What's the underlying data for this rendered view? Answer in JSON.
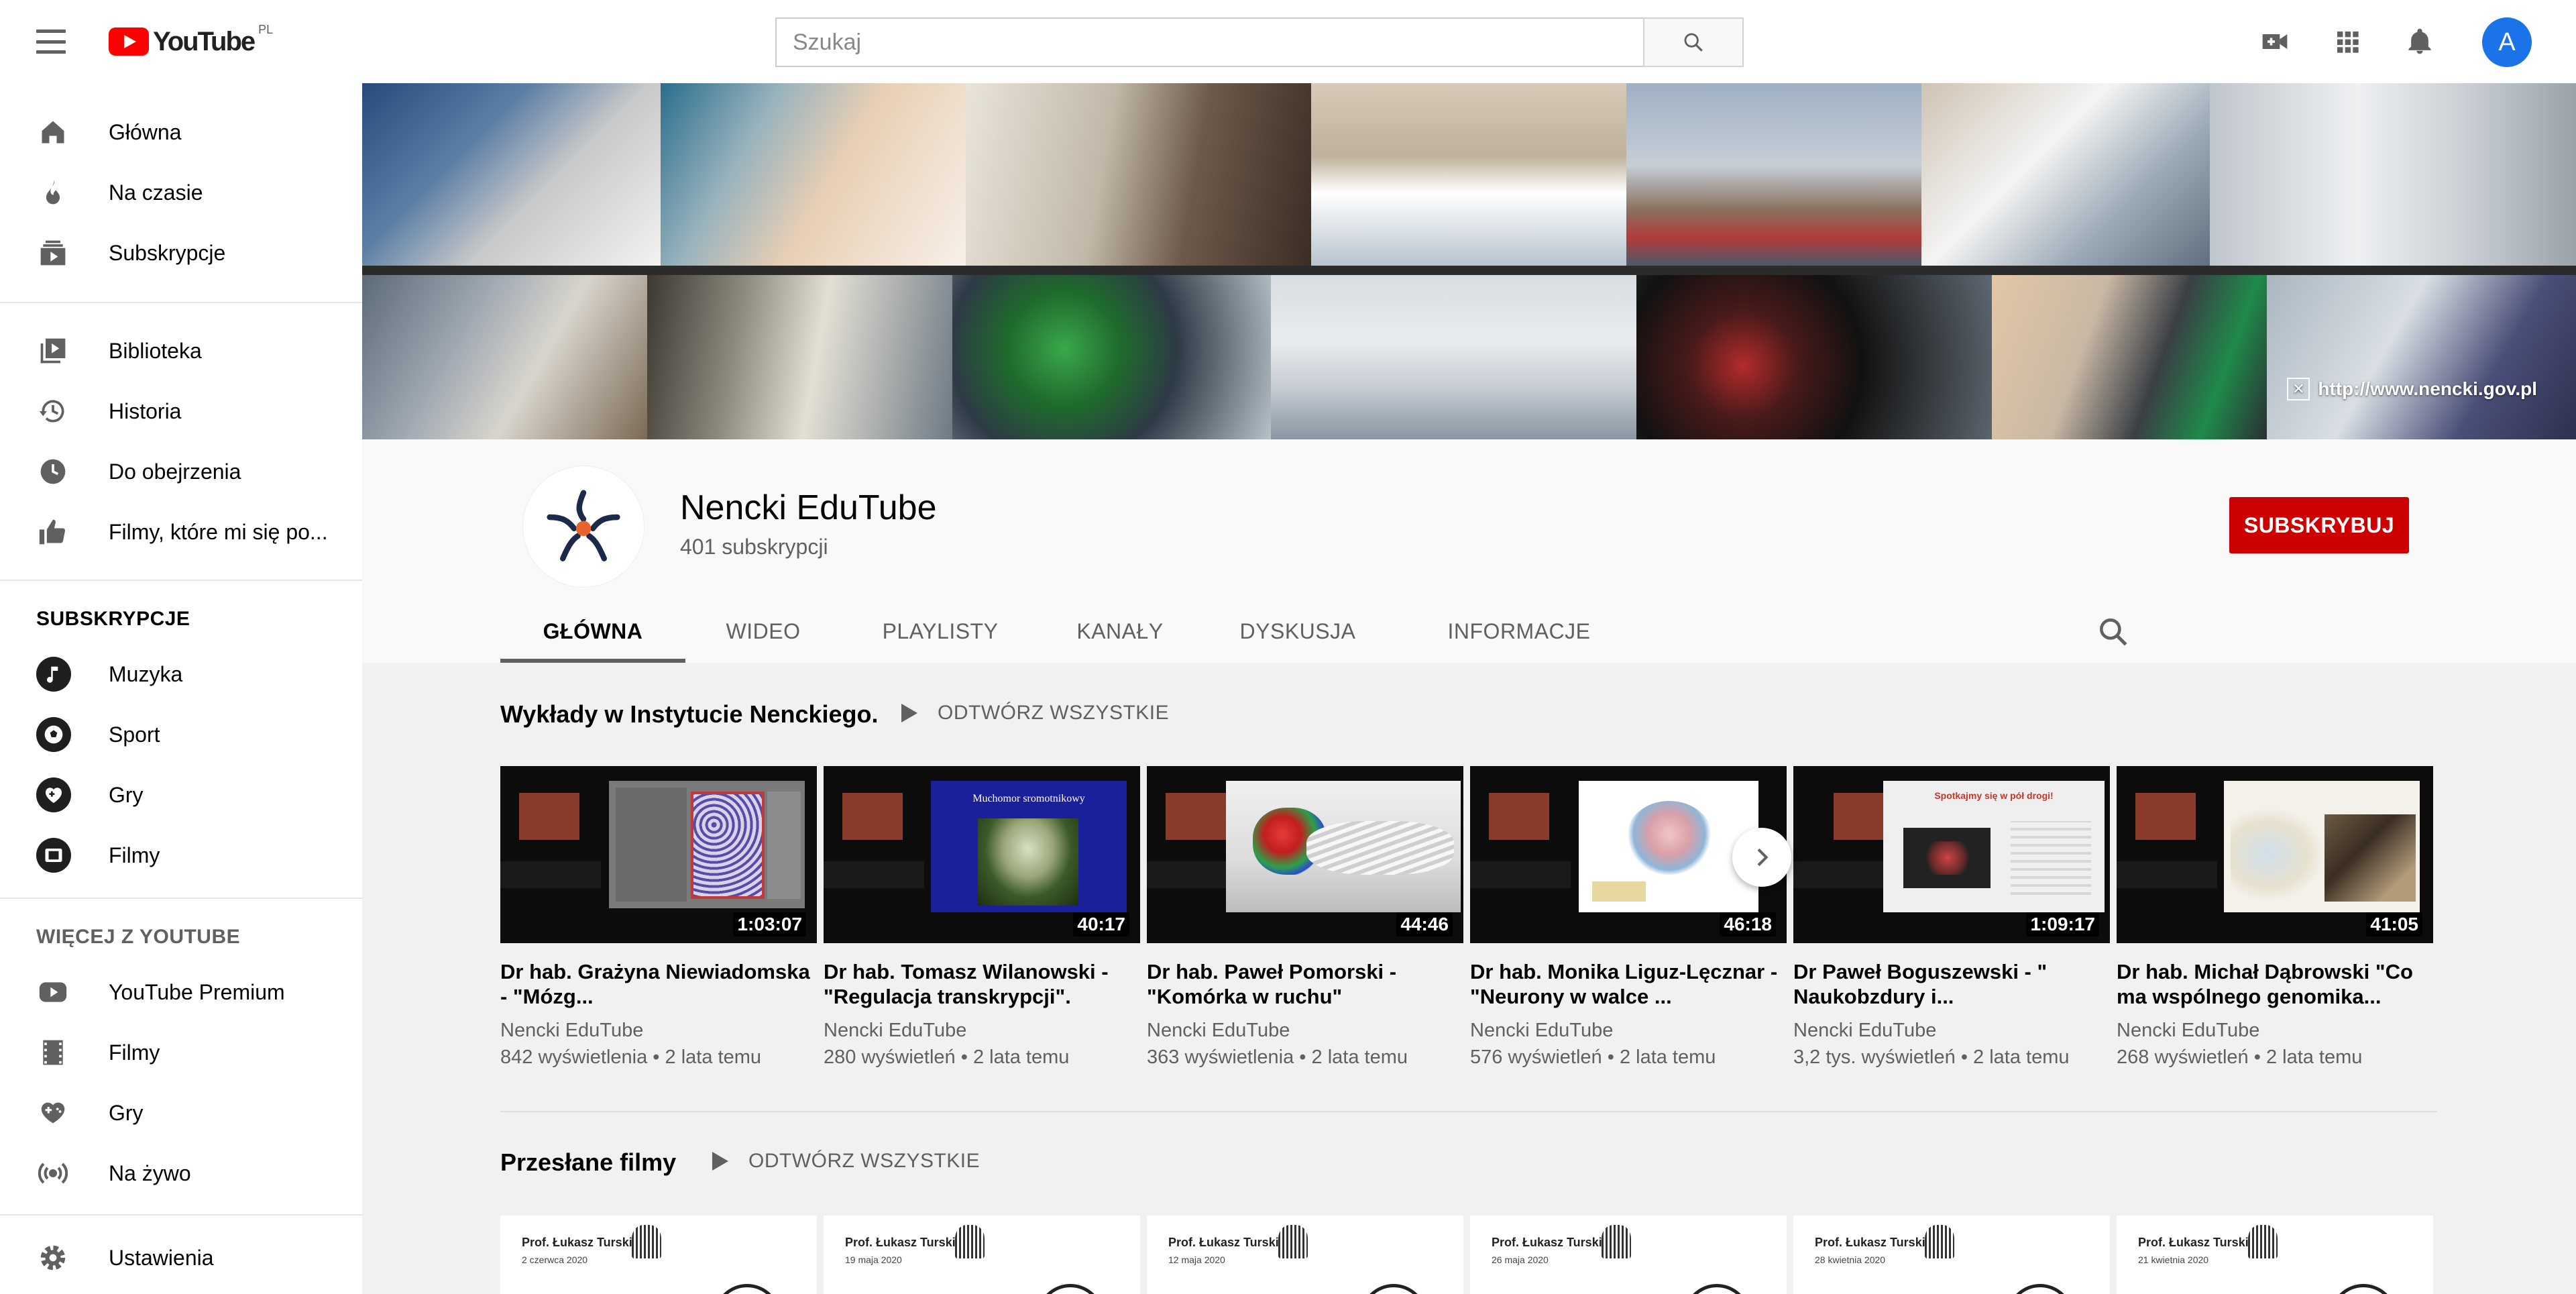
{
  "header": {
    "logo_text": "YouTube",
    "region": "PL",
    "search_placeholder": "Szukaj",
    "avatar_letter": "A",
    "icons": [
      "menu-icon",
      "search-icon",
      "create-video-icon",
      "apps-icon",
      "notifications-icon"
    ]
  },
  "sidebar": {
    "main": [
      {
        "label": "Główna",
        "icon": "home-icon"
      },
      {
        "label": "Na czasie",
        "icon": "fire-icon"
      },
      {
        "label": "Subskrypcje",
        "icon": "subscriptions-icon"
      }
    ],
    "library": [
      {
        "label": "Biblioteka",
        "icon": "library-icon"
      },
      {
        "label": "Historia",
        "icon": "history-icon"
      },
      {
        "label": "Do obejrzenia",
        "icon": "clock-icon"
      },
      {
        "label": "Filmy, które mi się po...",
        "icon": "thumbs-up-icon"
      }
    ],
    "subscriptions_heading": "SUBSKRYPCJE",
    "subscriptions": [
      {
        "label": "Muzyka",
        "icon": "music-icon"
      },
      {
        "label": "Sport",
        "icon": "sport-icon"
      },
      {
        "label": "Gry",
        "icon": "gaming-icon"
      },
      {
        "label": "Filmy",
        "icon": "film-icon"
      }
    ],
    "more_heading": "WIĘCEJ Z YOUTUBE",
    "more": [
      {
        "label": "YouTube Premium",
        "icon": "youtube-premium-icon"
      },
      {
        "label": "Filmy",
        "icon": "film-strip-icon"
      },
      {
        "label": "Gry",
        "icon": "gamepad-icon"
      },
      {
        "label": "Na żywo",
        "icon": "live-icon"
      }
    ],
    "settings": {
      "label": "Ustawienia",
      "icon": "settings-icon"
    }
  },
  "banner": {
    "url_text": "http://www.nencki.gov.pl"
  },
  "channel": {
    "name": "Nencki EduTube",
    "subscribers": "401 subskrypcji",
    "subscribe_label": "SUBSKRYBUJ",
    "tabs": [
      "GŁÓWNA",
      "WIDEO",
      "PLAYLISTY",
      "KANAŁY",
      "DYSKUSJA",
      "INFORMACJE"
    ],
    "active_tab": 0,
    "colors": {
      "subscribe": "#cc0000",
      "logo_orange": "#e8622a",
      "logo_navy": "#1b2a4a"
    }
  },
  "shelves": [
    {
      "title": "Wykłady w Instytucie Nenckiego.",
      "play_all": "ODTWÓRZ WSZYSTKIE",
      "videos": [
        {
          "title": "Dr hab. Grażyna Niewiadomska - \"Mózg...",
          "channel": "Nencki EduTube",
          "views": "842 wyświetlenia",
          "age": "2 lata temu",
          "duration": "1:03:07"
        },
        {
          "title": "Dr hab. Tomasz Wilanowski - \"Regulacja transkrypcji\".",
          "channel": "Nencki EduTube",
          "views": "280 wyświetleń",
          "age": "2 lata temu",
          "duration": "40:17",
          "slide_title": "Muchomor sromotnikowy"
        },
        {
          "title": "Dr hab. Paweł Pomorski - \"Komórka w ruchu\"",
          "channel": "Nencki EduTube",
          "views": "363 wyświetlenia",
          "age": "2 lata temu",
          "duration": "44:46"
        },
        {
          "title": "Dr hab. Monika Liguz-Lęcznar - \"Neurony w walce ...",
          "channel": "Nencki EduTube",
          "views": "576 wyświetleń",
          "age": "2 lata temu",
          "duration": "46:18"
        },
        {
          "title": "Dr Paweł Boguszewski - \" Naukobzdury i...",
          "channel": "Nencki EduTube",
          "views": "3,2 tys. wyświetleń",
          "age": "2 lata temu",
          "duration": "1:09:17",
          "slide_title": "Spotkajmy się w pół drogi!"
        },
        {
          "title": "Dr hab. Michał Dąbrowski \"Co ma wspólnego genomika...",
          "channel": "Nencki EduTube",
          "views": "268 wyświetleń",
          "age": "2 lata temu",
          "duration": "41:05"
        }
      ]
    },
    {
      "title": "Przesłane filmy",
      "play_all": "ODTWÓRZ WSZYSTKIE",
      "uploads": [
        {
          "speaker": "Prof. Łukasz Turski",
          "date": "2 czerwca 2020"
        },
        {
          "speaker": "Prof. Łukasz Turski",
          "date": "19 maja 2020"
        },
        {
          "speaker": "Prof. Łukasz Turski",
          "date": "12 maja 2020"
        },
        {
          "speaker": "Prof. Łukasz Turski",
          "date": "26 maja 2020"
        },
        {
          "speaker": "Prof. Łukasz Turski",
          "date": "28 kwietnia 2020"
        },
        {
          "speaker": "Prof. Łukasz Turski",
          "date": "21 kwietnia 2020"
        }
      ]
    }
  ]
}
